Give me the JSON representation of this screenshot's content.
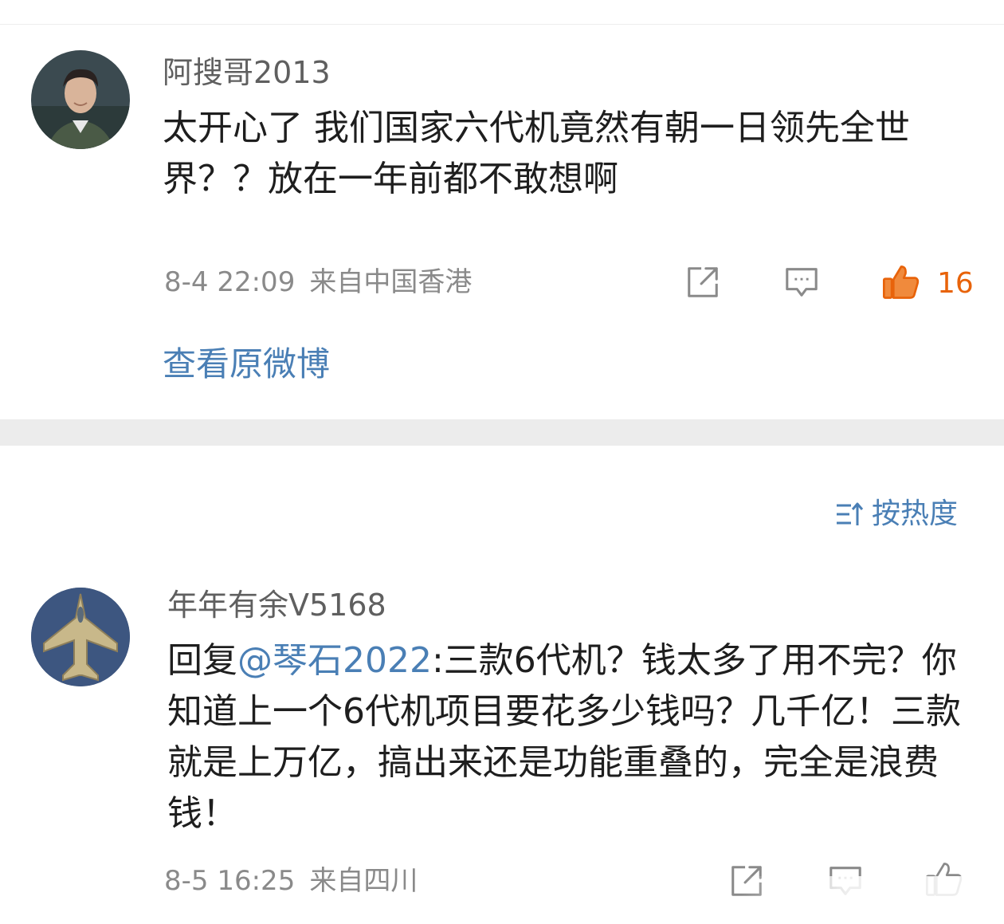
{
  "colors": {
    "link": "#4a7fb5",
    "like_active": "#e8630a",
    "meta_text": "#8a8a8a",
    "divider_band": "#ececec"
  },
  "comments": [
    {
      "username": "阿搜哥2013",
      "avatar_icon": "user-portrait-avatar",
      "content": "太开心了  我们国家六代机竟然有朝一日领先全世界？？放在一年前都不敢想啊",
      "time": "8-4 22:09",
      "location": "来自中国香港",
      "like_count": "16",
      "liked": true,
      "view_original_label": "查看原微博"
    },
    {
      "username": "年年有余V5168",
      "avatar_icon": "fighter-jet-avatar",
      "reply_prefix": "回复",
      "mention": "@琴石2022",
      "content": ":三款6代机？钱太多了用不完？你知道上一个6代机项目要花多少钱吗？几千亿！三款就是上万亿，搞出来还是功能重叠的，完全是浪费钱！",
      "time": "8-5 16:25",
      "location": "来自四川",
      "liked": false
    }
  ],
  "sort_label": "按热度",
  "icons": {
    "share": "share-icon",
    "comment": "comment-icon",
    "like": "thumbs-up-icon",
    "sort": "sort-icon"
  }
}
